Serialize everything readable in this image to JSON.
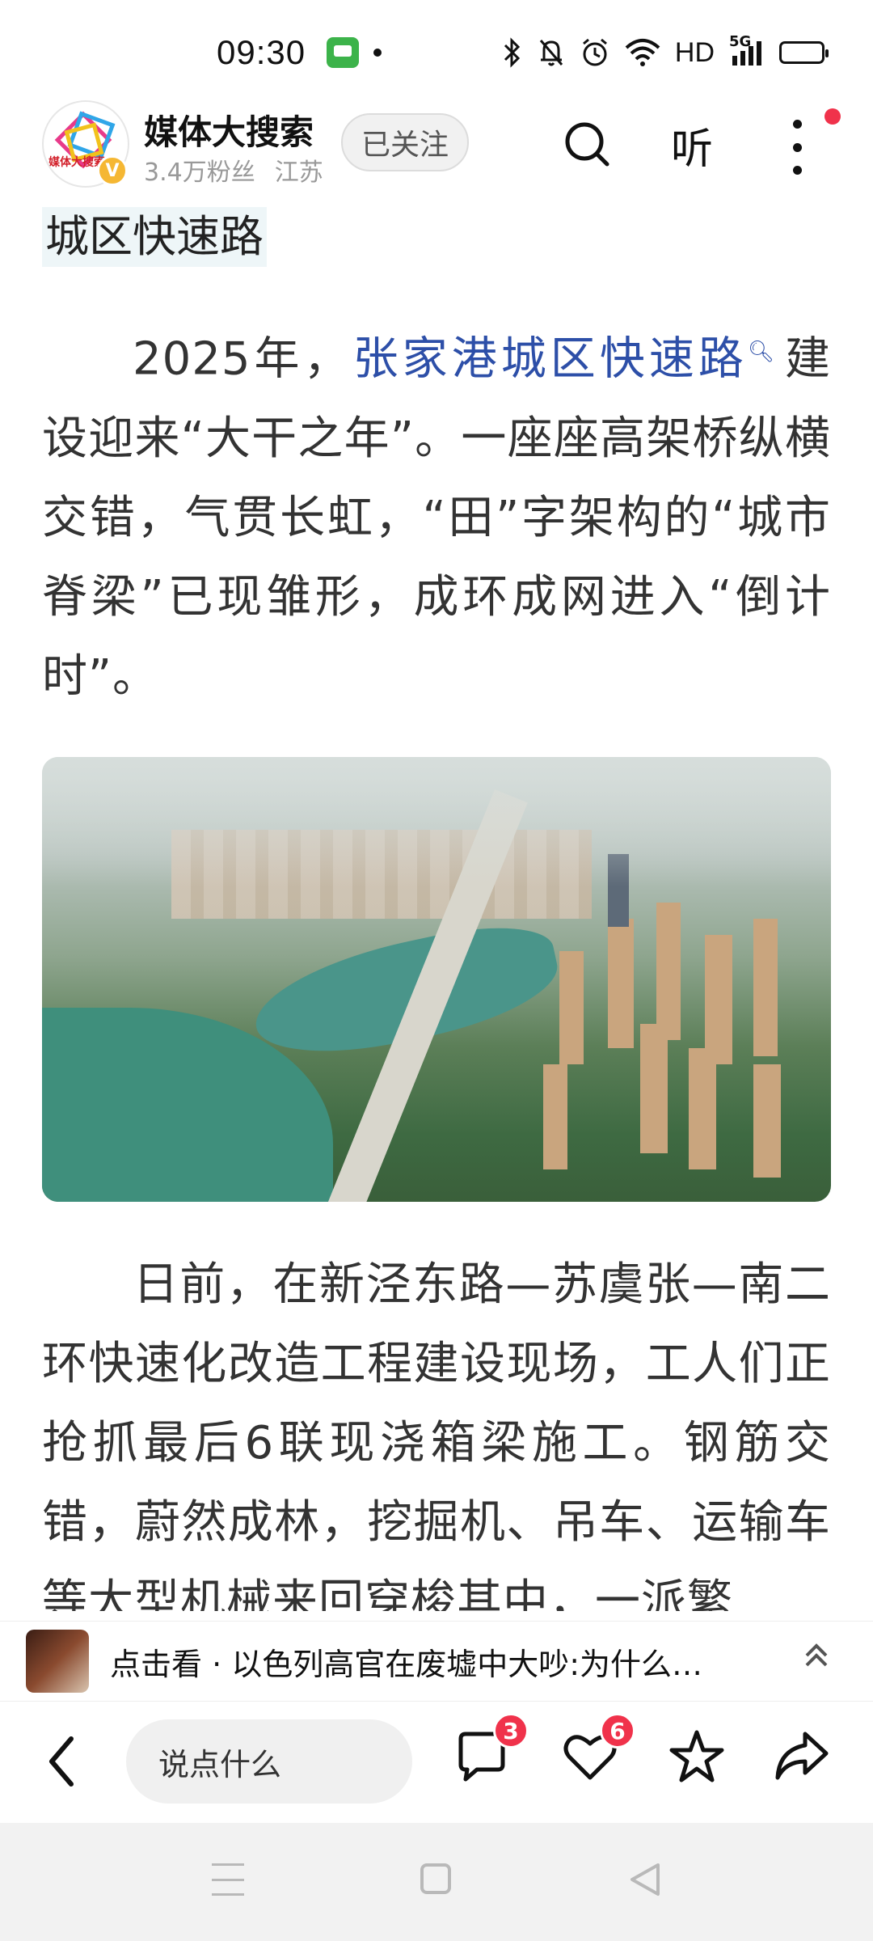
{
  "status_bar": {
    "time": "09:30",
    "network_label": "HD",
    "signal_label": "5G"
  },
  "header": {
    "account_name": "媒体大搜索",
    "avatar_logo_text": "媒体大搜索",
    "followers": "3.4万粉丝",
    "location": "江苏",
    "follow_label": "已关注",
    "listen_label": "听",
    "verified_mark": "V"
  },
  "article": {
    "section_heading": "城区快速路",
    "para1_before": "2025年，",
    "para1_link": "张家港城区快速路",
    "para1_after": "建设迎来“大干之年”。一座座高架桥纵横交错，气贯长虹，“田”字架构的“城市脊梁”已现雏形，成环成网进入“倒计时”。",
    "para2": "日前，在新泾东路—苏虞张—南二环快速化改造工程建设现场，工人们正抢抓最后6联现浇箱梁施工。钢筋交错，蔚然成林，挖掘机、吊车、运输车等大型机械来回穿梭其中，一派繁"
  },
  "recommend": {
    "text": "点击看 · 以色列高官在废墟中大吵:为什么…"
  },
  "action_bar": {
    "comment_placeholder": "说点什么",
    "comment_count": "3",
    "like_count": "6"
  }
}
